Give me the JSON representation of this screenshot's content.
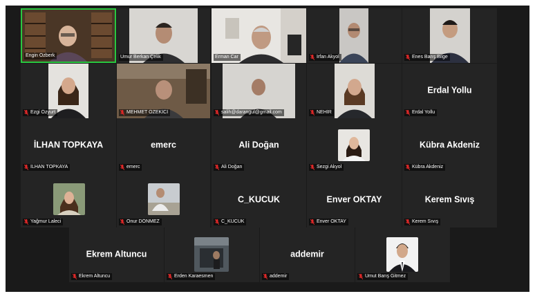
{
  "colors": {
    "stage_bg": "#1a1a1a",
    "tile_bg": "#242424",
    "active_speaker_border": "#28c840",
    "muted_icon": "#e02828"
  },
  "icons": {
    "muted": "mic-off-icon"
  },
  "participants": [
    {
      "name": "Engin Özberk",
      "muted": false,
      "video": true,
      "active": true
    },
    {
      "name": "Umur Berkan Çelik",
      "muted": false,
      "video": true
    },
    {
      "name": "Erman Car",
      "muted": false,
      "video": true
    },
    {
      "name": "İrfan Akyol",
      "muted": true,
      "video": true
    },
    {
      "name": "Enes Barış Bilge",
      "muted": true,
      "video": true
    },
    {
      "name": "Ezgi Özyurt",
      "muted": true,
      "video": true
    },
    {
      "name": "MEHMET ÖZEKİCİ",
      "muted": true,
      "video": true
    },
    {
      "name": "salih@darangul@gmail.com",
      "muted": true,
      "video": true
    },
    {
      "name": "NEHİR",
      "muted": true,
      "video": true
    },
    {
      "name": "Erdal Yollu",
      "muted": true,
      "video": false
    },
    {
      "name": "İLHAN TOPKAYA",
      "muted": true,
      "video": false
    },
    {
      "name": "emerc",
      "muted": true,
      "video": false
    },
    {
      "name": "Ali Doğan",
      "muted": true,
      "video": false
    },
    {
      "name": "Sezgi Akyol",
      "muted": true,
      "video": false,
      "photo": true
    },
    {
      "name": "Kübra Akdeniz",
      "muted": true,
      "video": false
    },
    {
      "name": "Yağmur Laleci",
      "muted": true,
      "video": false,
      "photo": true
    },
    {
      "name": "Onur DÖNMEZ",
      "muted": true,
      "video": false,
      "photo": true
    },
    {
      "name": "C_KUCUK",
      "muted": true,
      "video": false
    },
    {
      "name": "Enver OKTAY",
      "muted": true,
      "video": false
    },
    {
      "name": "Kerem Sıvış",
      "muted": true,
      "video": false
    },
    {
      "name": "Ekrem Altuncu",
      "muted": true,
      "video": false
    },
    {
      "name": "Erden Karaesmen",
      "muted": true,
      "video": false,
      "photo": true
    },
    {
      "name": "addemir",
      "muted": true,
      "video": false
    },
    {
      "name": "Umut Barış Gitmez",
      "muted": true,
      "video": false,
      "photo": true
    }
  ]
}
